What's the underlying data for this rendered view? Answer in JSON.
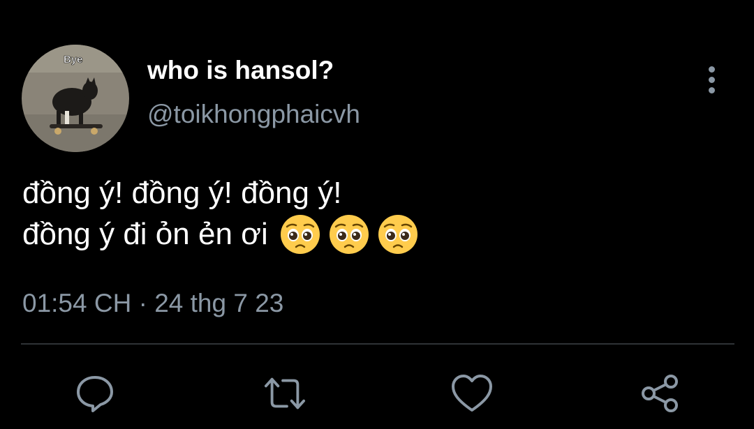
{
  "tweet": {
    "author": {
      "display_name": "who is hansol?",
      "handle": "@toikhongphaicvh",
      "avatar_caption": "Bye"
    },
    "text_line_1": "đồng ý! đồng ý! đồng ý!",
    "text_line_2": "đồng ý đi ỏn ẻn ơi",
    "emojis": [
      "pleading-face",
      "pleading-face",
      "pleading-face"
    ],
    "timestamp": "01:54 CH · 24 thg 7 23"
  },
  "actions": [
    {
      "icon": "reply-icon"
    },
    {
      "icon": "retweet-icon"
    },
    {
      "icon": "like-icon"
    },
    {
      "icon": "share-icon"
    }
  ],
  "colors": {
    "background": "#000000",
    "primary_text": "#ffffff",
    "secondary_text": "#8b98a5",
    "divider": "#2f3336"
  }
}
